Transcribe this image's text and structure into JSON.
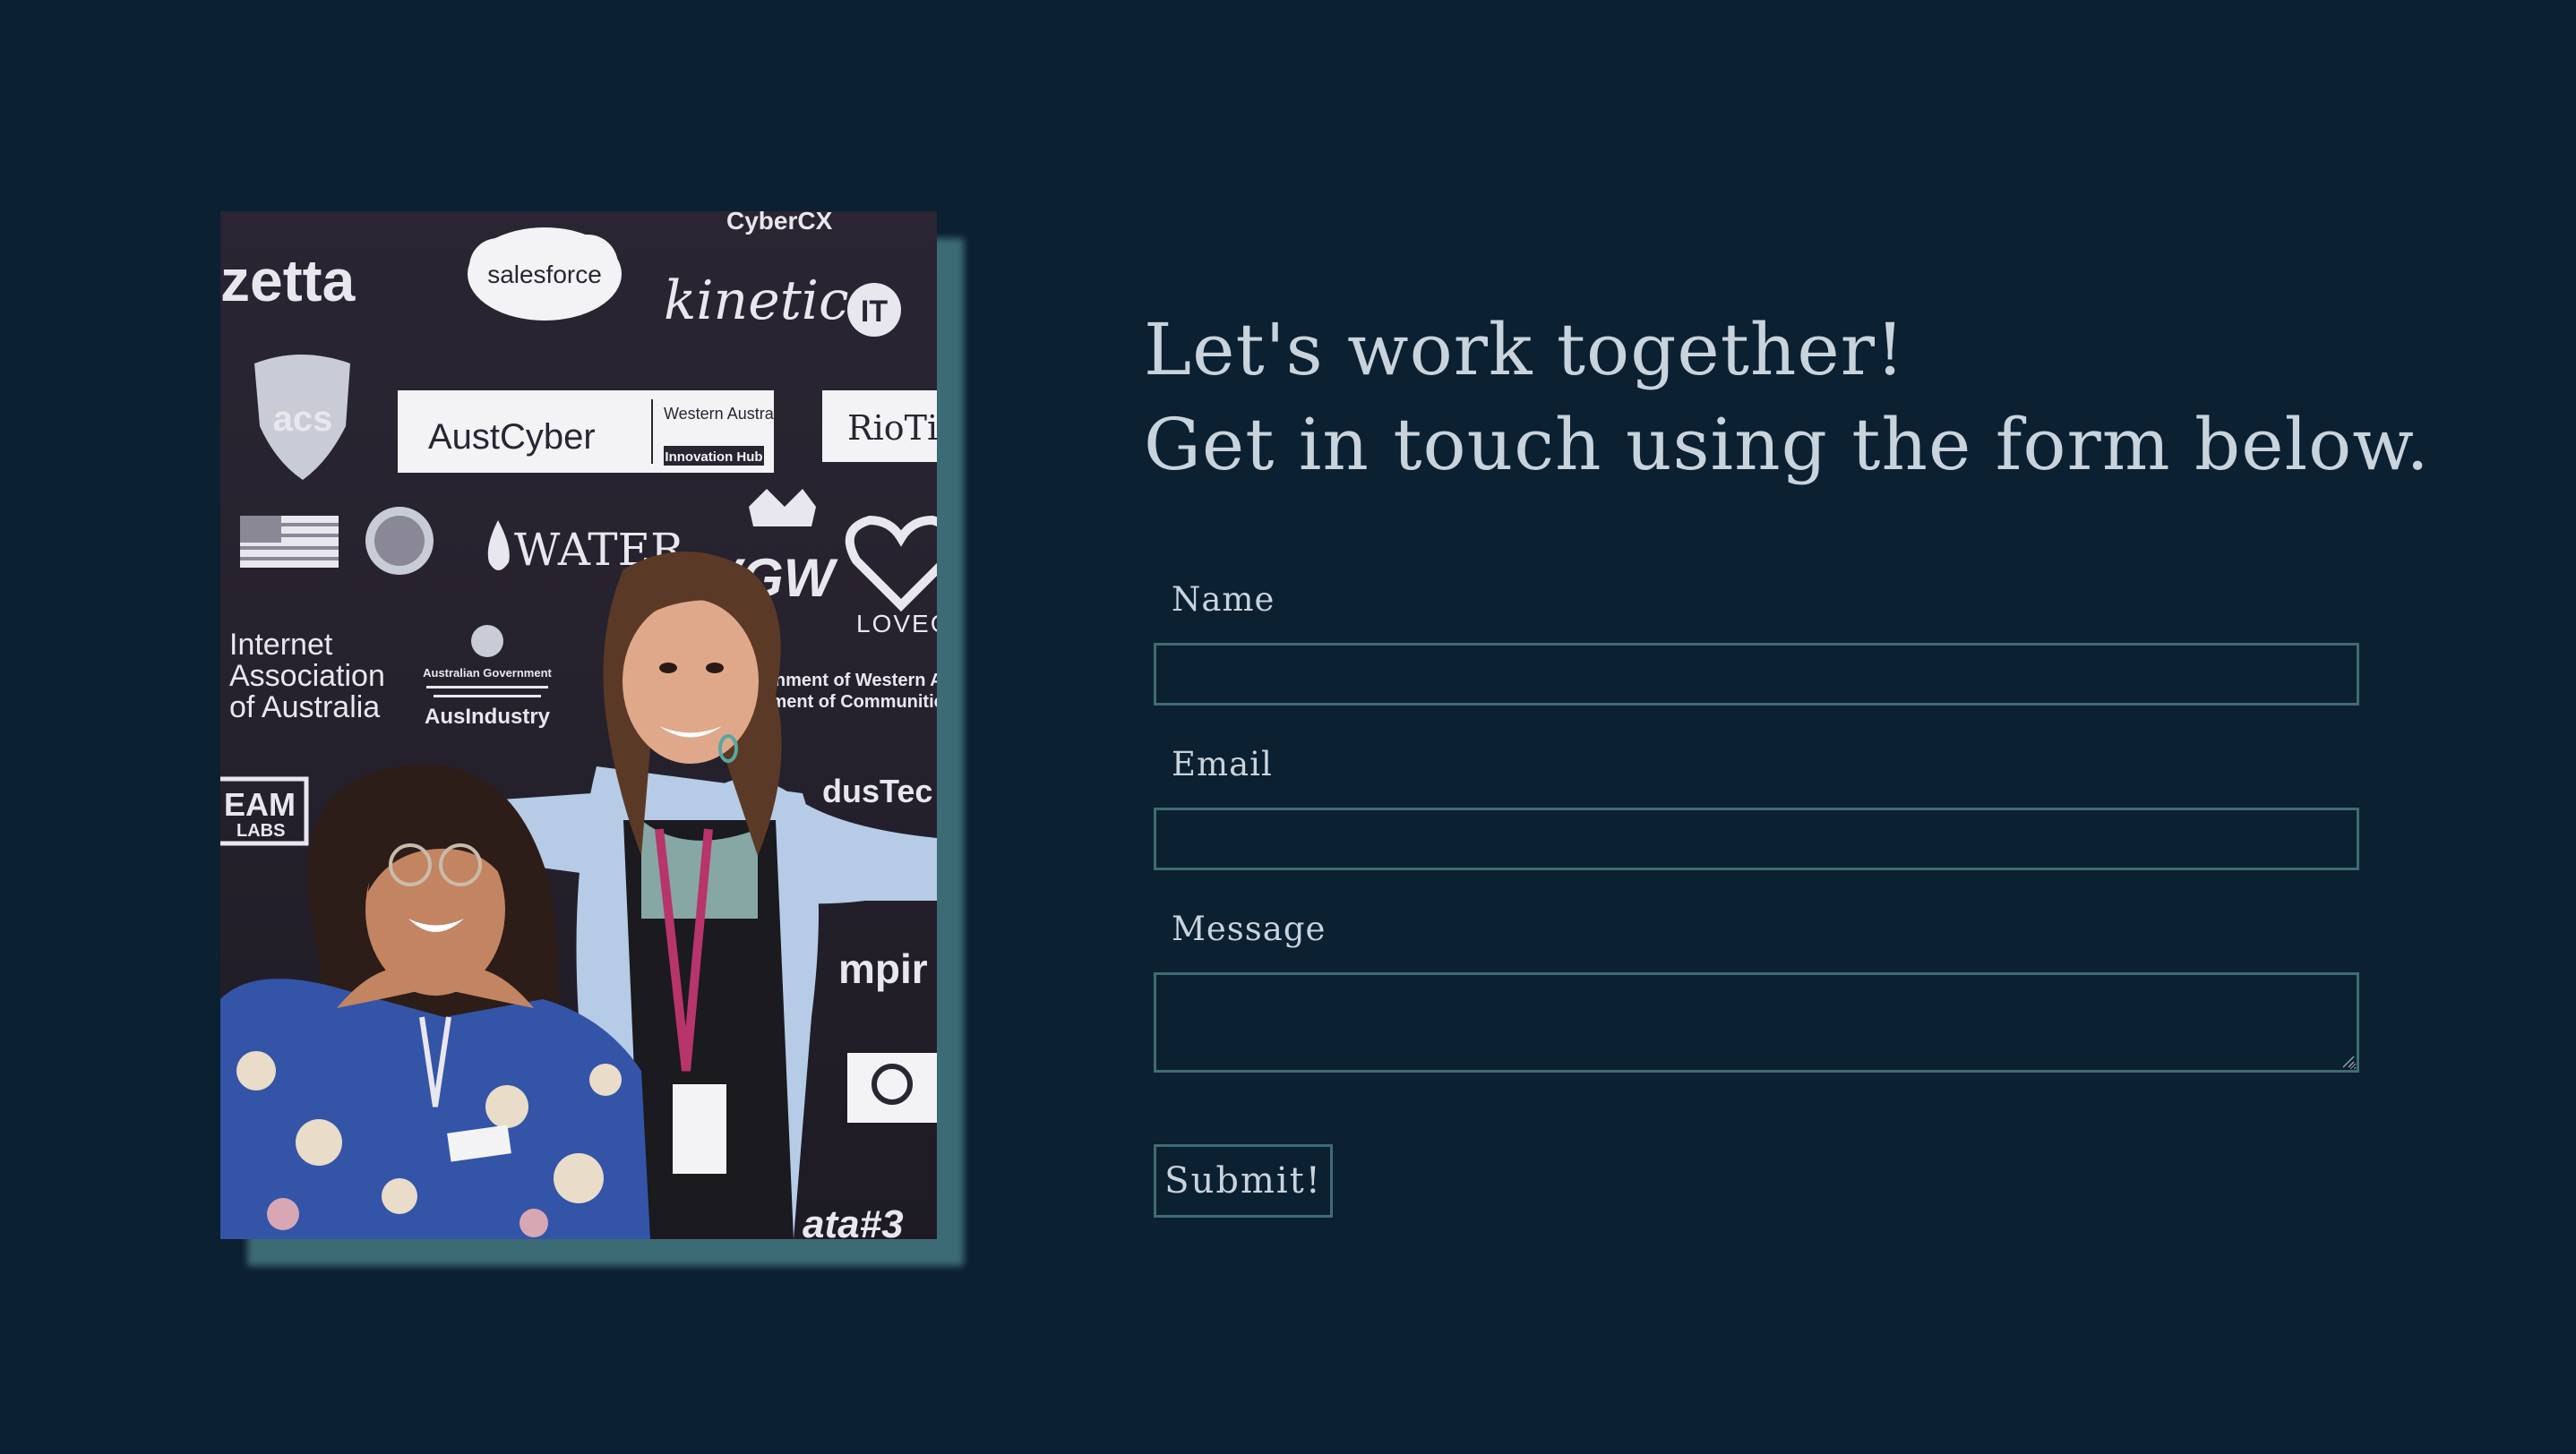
{
  "headline": {
    "line1": "Let's work together!",
    "line2": "Get in touch using the form below."
  },
  "form": {
    "name_label": "Name",
    "name_value": "",
    "email_label": "Email",
    "email_value": "",
    "message_label": "Message",
    "message_value": "",
    "submit_label": "Submit!"
  },
  "photo": {
    "backdrop_logos": [
      "zetta",
      "salesforce",
      "CyberCX",
      "kinetic",
      "IT",
      "acs",
      "AustCyber",
      "Western Australia",
      "Innovation Hub",
      "RioTin",
      "WATER",
      "VGW",
      "LOVEG",
      "Internet",
      "Association",
      "of Australia",
      "Australian Government",
      "AusIndustry",
      "ernment of Western A",
      "rtment of Communities",
      "EAM",
      "LABS",
      "dusTec",
      "mpir",
      "ata#3"
    ]
  },
  "colors": {
    "background": "#0b2030",
    "text": "#c9d3dc",
    "border": "#3f6c74",
    "photo_shadow": "#3d6b75"
  }
}
